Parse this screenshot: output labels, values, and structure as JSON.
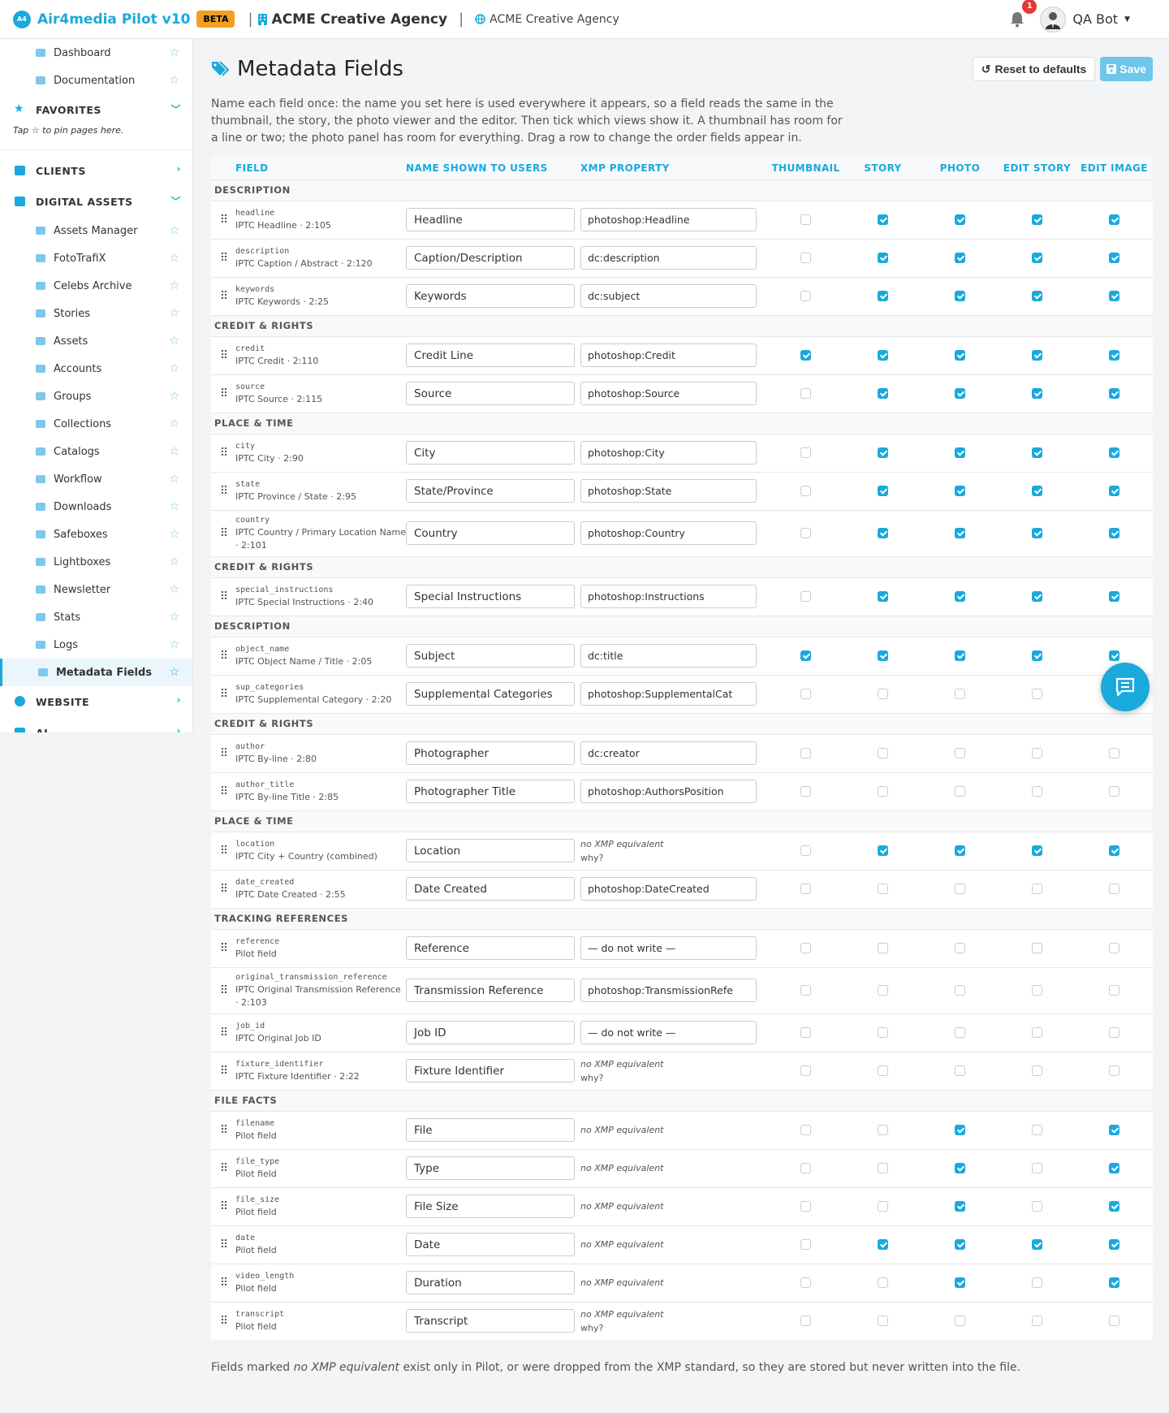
{
  "topbar": {
    "brand": "Air4media Pilot v10",
    "beta": "BETA",
    "agency": "ACME Creative Agency",
    "agency_secondary": "ACME Creative Agency",
    "notification_count": "1",
    "user": "QA Bot"
  },
  "sidebar": {
    "top_items": [
      {
        "label": "Dashboard"
      },
      {
        "label": "Documentation"
      }
    ],
    "favorites_label": "FAVORITES",
    "favorites_note": "Tap ☆ to pin pages here.",
    "clients_label": "CLIENTS",
    "digital_assets_label": "DIGITAL ASSETS",
    "items": [
      {
        "label": "Assets Manager"
      },
      {
        "label": "FotoTrafiX"
      },
      {
        "label": "Celebs Archive"
      },
      {
        "label": "Stories"
      },
      {
        "label": "Assets"
      },
      {
        "label": "Accounts"
      },
      {
        "label": "Groups"
      },
      {
        "label": "Collections"
      },
      {
        "label": "Catalogs"
      },
      {
        "label": "Workflow"
      },
      {
        "label": "Downloads"
      },
      {
        "label": "Safeboxes"
      },
      {
        "label": "Lightboxes"
      },
      {
        "label": "Newsletter"
      },
      {
        "label": "Stats"
      },
      {
        "label": "Logs"
      },
      {
        "label": "Metadata Fields"
      }
    ],
    "website_label": "WEBSITE",
    "ai_label": "AI"
  },
  "page": {
    "title": "Metadata Fields",
    "reset_label": "Reset to defaults",
    "save_label": "Save",
    "intro": "Name each field once: the name you set here is used everywhere it appears, so a field reads the same in the thumbnail, the story, the photo viewer and the editor. Then tick which views show it. A thumbnail has room for a line or two; the photo panel has room for everything. Drag a row to change the order fields appear in.",
    "footer_pre": "Fields marked ",
    "footer_em": "no XMP equivalent",
    "footer_post": " exist only in Pilot, or were dropped from the XMP standard, so they are stored but never written into the file."
  },
  "table": {
    "headers": {
      "field": "FIELD",
      "name": "NAME SHOWN TO USERS",
      "xmp": "XMP PROPERTY",
      "thumbnail": "THUMBNAIL",
      "story": "STORY",
      "photo": "PHOTO",
      "edit_story": "EDIT STORY",
      "edit_image": "EDIT IMAGE"
    },
    "no_xmp": "no XMP equivalent",
    "why": "why?",
    "groups": [
      {
        "label": "DESCRIPTION",
        "rows": [
          {
            "key": "headline",
            "sub": "IPTC Headline · 2:105",
            "name": "Headline",
            "xmp": "photoshop:Headline",
            "checks": [
              0,
              1,
              1,
              1,
              1
            ]
          },
          {
            "key": "description",
            "sub": "IPTC Caption / Abstract · 2:120",
            "name": "Caption/Description",
            "xmp": "dc:description",
            "checks": [
              0,
              1,
              1,
              1,
              1
            ]
          },
          {
            "key": "keywords",
            "sub": "IPTC Keywords · 2:25",
            "name": "Keywords",
            "xmp": "dc:subject",
            "checks": [
              0,
              1,
              1,
              1,
              1
            ]
          }
        ]
      },
      {
        "label": "CREDIT & RIGHTS",
        "rows": [
          {
            "key": "credit",
            "sub": "IPTC Credit · 2:110",
            "name": "Credit Line",
            "xmp": "photoshop:Credit",
            "checks": [
              1,
              1,
              1,
              1,
              1
            ]
          },
          {
            "key": "source",
            "sub": "IPTC Source · 2:115",
            "name": "Source",
            "xmp": "photoshop:Source",
            "checks": [
              0,
              1,
              1,
              1,
              1
            ]
          }
        ]
      },
      {
        "label": "PLACE & TIME",
        "rows": [
          {
            "key": "city",
            "sub": "IPTC City · 2:90",
            "name": "City",
            "xmp": "photoshop:City",
            "checks": [
              0,
              1,
              1,
              1,
              1
            ]
          },
          {
            "key": "state",
            "sub": "IPTC Province / State · 2:95",
            "name": "State/Province",
            "xmp": "photoshop:State",
            "checks": [
              0,
              1,
              1,
              1,
              1
            ]
          },
          {
            "key": "country",
            "sub": "IPTC Country / Primary Location Name · 2:101",
            "name": "Country",
            "xmp": "photoshop:Country",
            "checks": [
              0,
              1,
              1,
              1,
              1
            ]
          }
        ]
      },
      {
        "label": "CREDIT & RIGHTS",
        "rows": [
          {
            "key": "special_instructions",
            "sub": "IPTC Special Instructions · 2:40",
            "name": "Special Instructions",
            "xmp": "photoshop:Instructions",
            "checks": [
              0,
              1,
              1,
              1,
              1
            ]
          }
        ]
      },
      {
        "label": "DESCRIPTION",
        "rows": [
          {
            "key": "object_name",
            "sub": "IPTC Object Name / Title · 2:05",
            "name": "Subject",
            "xmp": "dc:title",
            "checks": [
              1,
              1,
              1,
              1,
              1
            ]
          },
          {
            "key": "sup_categories",
            "sub": "IPTC Supplemental Category · 2:20",
            "name": "Supplemental Categories",
            "xmp": "photoshop:SupplementalCat",
            "checks": [
              0,
              0,
              0,
              0,
              0
            ]
          }
        ]
      },
      {
        "label": "CREDIT & RIGHTS",
        "rows": [
          {
            "key": "author",
            "sub": "IPTC By-line · 2:80",
            "name": "Photographer",
            "xmp": "dc:creator",
            "checks": [
              0,
              0,
              0,
              0,
              0
            ]
          },
          {
            "key": "author_title",
            "sub": "IPTC By-line Title · 2:85",
            "name": "Photographer Title",
            "xmp": "photoshop:AuthorsPosition",
            "checks": [
              0,
              0,
              0,
              0,
              0
            ]
          }
        ]
      },
      {
        "label": "PLACE & TIME",
        "rows": [
          {
            "key": "location",
            "sub": "IPTC City + Country (combined)",
            "name": "Location",
            "xmp": "",
            "noxmp": true,
            "why": true,
            "checks": [
              0,
              1,
              1,
              1,
              1
            ]
          },
          {
            "key": "date_created",
            "sub": "IPTC Date Created · 2:55",
            "name": "Date Created",
            "xmp": "photoshop:DateCreated",
            "checks": [
              0,
              0,
              0,
              0,
              0
            ]
          }
        ]
      },
      {
        "label": "TRACKING REFERENCES",
        "rows": [
          {
            "key": "reference",
            "sub": "Pilot field",
            "name": "Reference",
            "xmp": "— do not write —",
            "checks": [
              0,
              0,
              0,
              0,
              0
            ]
          },
          {
            "key": "original_transmission_reference",
            "sub": "IPTC Original Transmission Reference · 2:103",
            "name": "Transmission Reference",
            "xmp": "photoshop:TransmissionRefe",
            "checks": [
              0,
              0,
              0,
              0,
              0
            ]
          },
          {
            "key": "job_id",
            "sub": "IPTC Original Job ID",
            "name": "Job ID",
            "xmp": "— do not write —",
            "checks": [
              0,
              0,
              0,
              0,
              0
            ]
          },
          {
            "key": "fixture_identifier",
            "sub": "IPTC Fixture Identifier · 2:22",
            "name": "Fixture Identifier",
            "xmp": "",
            "noxmp": true,
            "why": true,
            "checks": [
              0,
              0,
              0,
              0,
              0
            ]
          }
        ]
      },
      {
        "label": "FILE FACTS",
        "rows": [
          {
            "key": "filename",
            "sub": "Pilot field",
            "name": "File",
            "xmp": "",
            "noxmp": true,
            "checks": [
              0,
              0,
              1,
              0,
              1
            ]
          },
          {
            "key": "file_type",
            "sub": "Pilot field",
            "name": "Type",
            "xmp": "",
            "noxmp": true,
            "checks": [
              0,
              0,
              1,
              0,
              1
            ]
          },
          {
            "key": "file_size",
            "sub": "Pilot field",
            "name": "File Size",
            "xmp": "",
            "noxmp": true,
            "checks": [
              0,
              0,
              1,
              0,
              1
            ]
          },
          {
            "key": "date",
            "sub": "Pilot field",
            "name": "Date",
            "xmp": "",
            "noxmp": true,
            "checks": [
              0,
              1,
              1,
              1,
              1
            ]
          },
          {
            "key": "video_length",
            "sub": "Pilot field",
            "name": "Duration",
            "xmp": "",
            "noxmp": true,
            "checks": [
              0,
              0,
              1,
              0,
              1
            ]
          },
          {
            "key": "transcript",
            "sub": "Pilot field",
            "name": "Transcript",
            "xmp": "",
            "noxmp": true,
            "why": true,
            "checks": [
              0,
              0,
              0,
              0,
              0
            ]
          }
        ]
      }
    ]
  },
  "colors": {
    "accent": "#1aa9dd",
    "beta": "#f0a020",
    "badge": "#e53935"
  },
  "icons": [
    "logo-icon",
    "building-icon",
    "globe-icon",
    "bell-icon",
    "caret-down-icon",
    "tag-icon",
    "undo-icon",
    "save-icon",
    "drag-handle-icon",
    "chat-icon",
    "star-icon",
    "chevron-icon"
  ]
}
